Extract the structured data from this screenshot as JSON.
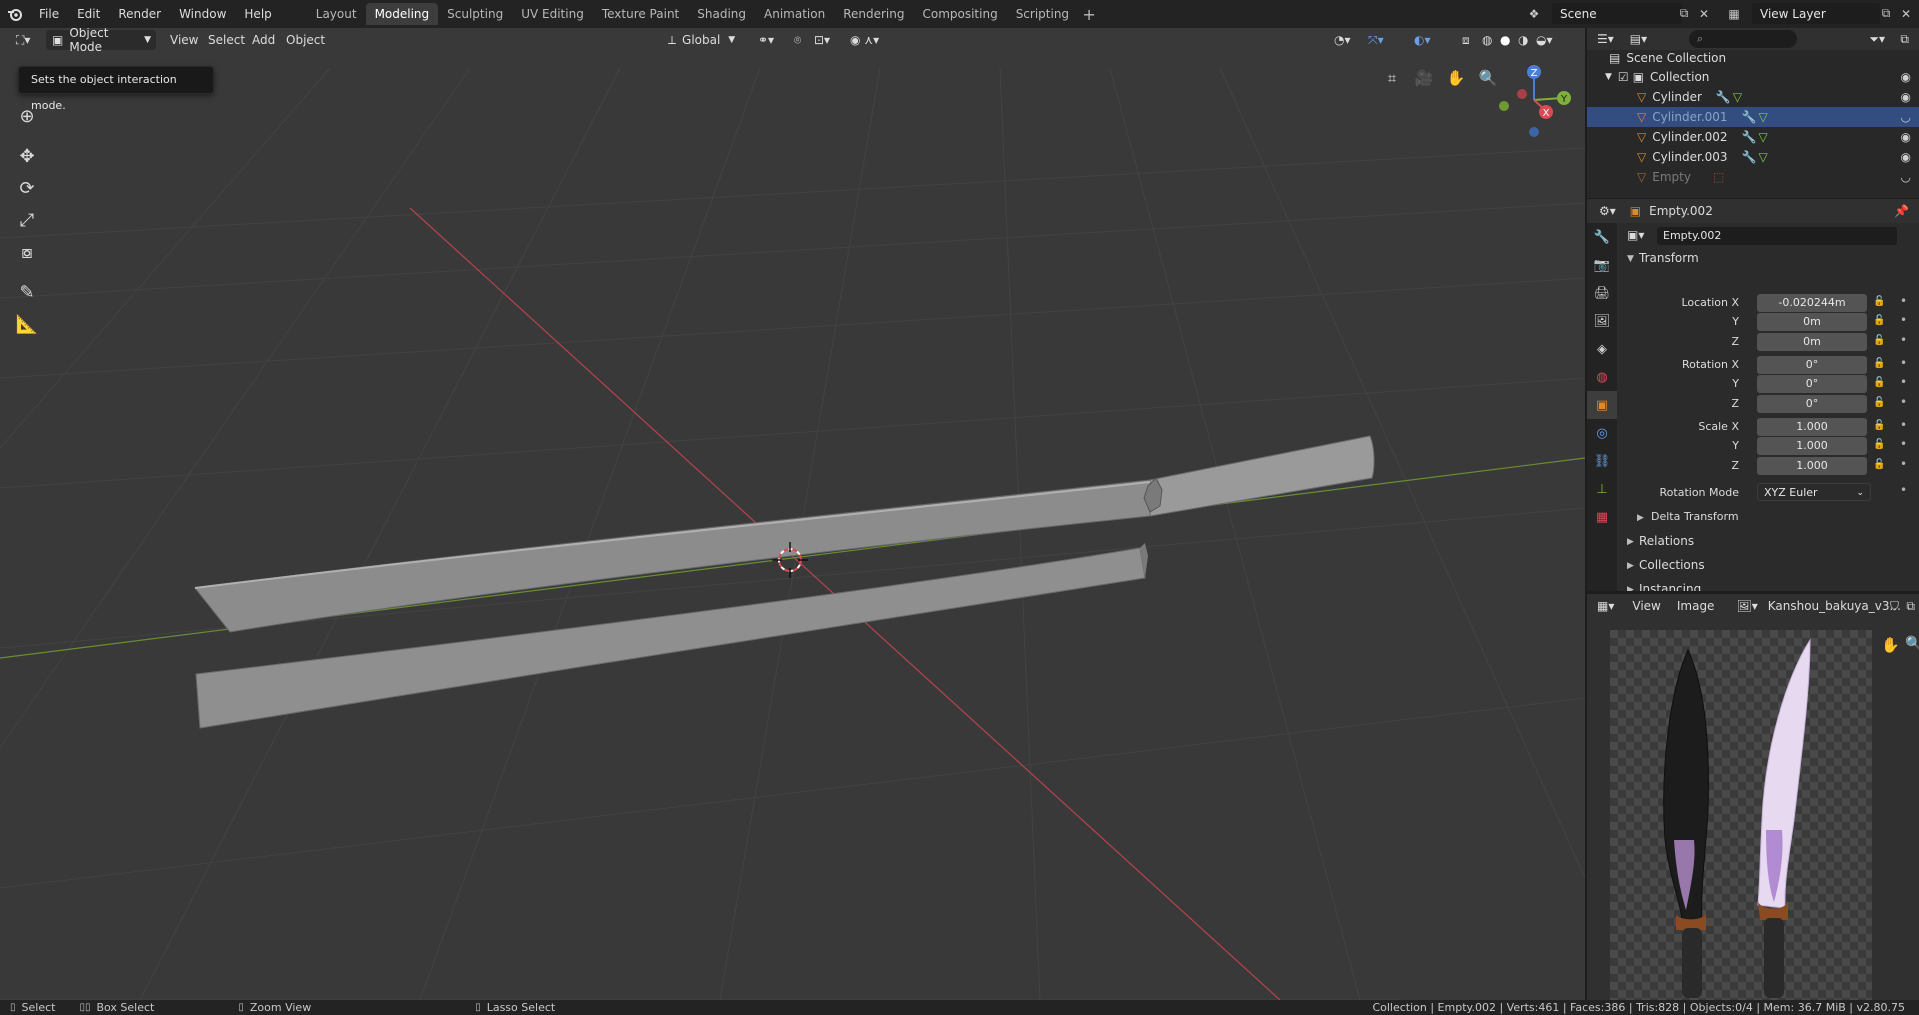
{
  "topbar": {
    "menus": [
      "File",
      "Edit",
      "Render",
      "Window",
      "Help"
    ],
    "workspaces": [
      "Layout",
      "Modeling",
      "Sculpting",
      "UV Editing",
      "Texture Paint",
      "Shading",
      "Animation",
      "Rendering",
      "Compositing",
      "Scripting"
    ],
    "active_workspace": "Modeling",
    "scene": "Scene",
    "view_layer": "View Layer"
  },
  "viewport": {
    "mode": "Object Mode",
    "menus": [
      "View",
      "Select",
      "Add",
      "Object"
    ],
    "transform_orientation": "Global",
    "tooltip": "Sets the object interaction mode.",
    "gizmo_axes": [
      "X",
      "Y",
      "Z"
    ]
  },
  "outliner": {
    "root": "Scene Collection",
    "collection": "Collection",
    "objects": [
      {
        "name": "Cylinder",
        "selected": false
      },
      {
        "name": "Cylinder.001",
        "selected": true
      },
      {
        "name": "Cylinder.002",
        "selected": false
      },
      {
        "name": "Cylinder.003",
        "selected": false
      },
      {
        "name": "Empty",
        "selected": false
      }
    ]
  },
  "properties": {
    "object_name_header": "Empty.002",
    "object_name_field": "Empty.002",
    "panel_transform": "Transform",
    "location_label": "Location X",
    "rotation_label": "Rotation X",
    "scale_label": "Scale X",
    "y_label": "Y",
    "z_label": "Z",
    "location": [
      "-0.020244m",
      "0m",
      "0m"
    ],
    "rotation": [
      "0°",
      "0°",
      "0°"
    ],
    "scale": [
      "1.000",
      "1.000",
      "1.000"
    ],
    "rotation_mode_label": "Rotation Mode",
    "rotation_mode": "XYZ Euler",
    "delta_transform": "Delta Transform",
    "relations": "Relations",
    "collections": "Collections",
    "instancing": "Instancing"
  },
  "image_editor": {
    "menus": [
      "View",
      "Image"
    ],
    "image_name": "Kanshou_bakuya_v3..."
  },
  "statusbar": {
    "select": "Select",
    "box_select": "Box Select",
    "zoom_view": "Zoom View",
    "lasso_select": "Lasso Select",
    "stats": "Collection | Empty.002 | Verts:461 | Faces:386 | Tris:828 | Objects:0/4 | Mem: 36.7 MiB | v2.80.75"
  },
  "colors": {
    "selection_blue": "#334d80",
    "axis_red": "#d94a56",
    "axis_green": "#7fb03b",
    "object_orange": "#e0882c"
  }
}
